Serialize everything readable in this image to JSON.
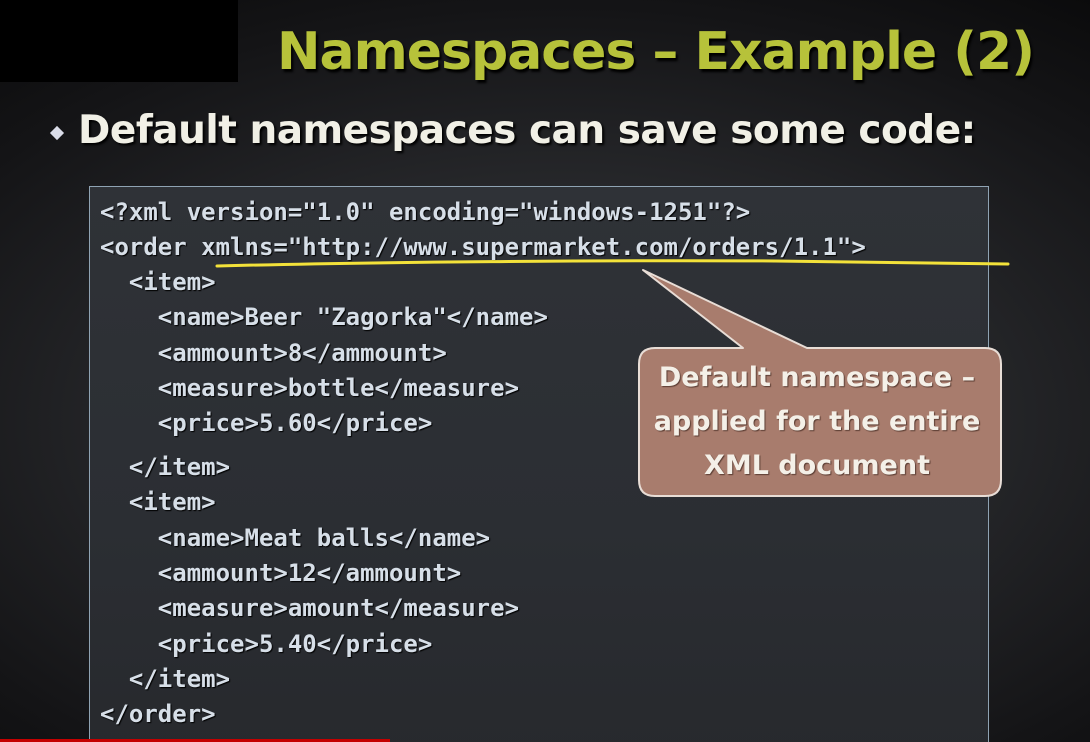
{
  "slide": {
    "title": "Namespaces – Example (2)",
    "bullet": "Default namespaces can save some code:",
    "code_lines": [
      "<?xml version=\"1.0\" encoding=\"windows-1251\"?>",
      "<order xmlns=\"http://www.supermarket.com/orders/1.1\">",
      "  <item>",
      "    <name>Beer \"Zagorka\"</name>",
      "    <ammount>8</ammount>",
      "    <measure>bottle</measure>",
      "    <price>5.60</price>",
      "  </item>",
      "  <item>",
      "    <name>Meat balls</name>",
      "    <ammount>12</ammount>",
      "    <measure>amount</measure>",
      "    <price>5.40</price>",
      "  </item>",
      "</order>"
    ],
    "callout_lines": [
      "Default namespace –",
      "applied for the entire",
      "XML document"
    ]
  },
  "colors": {
    "title": "#b7c23a",
    "bullet_text": "#f1f0e6",
    "code_text": "#d7dfe8",
    "highlight_underline": "#f3e23a",
    "callout_fill": "#a87c6d"
  },
  "icons": {
    "bullet": "diamond-bullet-icon"
  }
}
